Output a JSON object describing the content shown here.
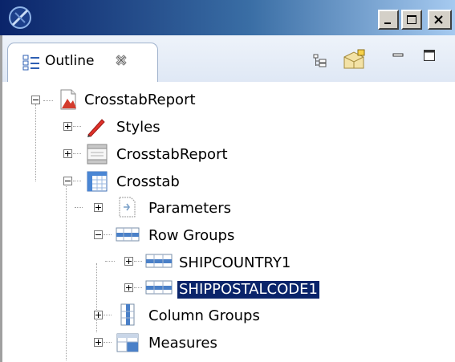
{
  "window": {
    "controls": {
      "minimize": "_",
      "maximize": "□",
      "close": "X"
    }
  },
  "outline_tab": {
    "label": "Outline",
    "icon": "outline-view-icon",
    "close_icon": "close-icon"
  },
  "toolbar": {
    "buttons": [
      "expand-all-icon",
      "filter-icon",
      "minimize-view-icon",
      "maximize-view-icon"
    ]
  },
  "tree": {
    "items": [
      {
        "label": "CrosstabReport",
        "icon": "report-icon",
        "expanded": true
      },
      {
        "label": "Styles",
        "icon": "pencil-icon",
        "expanded": false
      },
      {
        "label": "CrosstabReport",
        "icon": "master-page-icon",
        "expanded": false
      },
      {
        "label": "Crosstab",
        "icon": "crosstab-icon",
        "expanded": true
      },
      {
        "label": "Parameters",
        "icon": "parameters-icon",
        "expanded": false
      },
      {
        "label": "Row Groups",
        "icon": "row-group-icon",
        "expanded": true
      },
      {
        "label": "SHIPCOUNTRY1",
        "icon": "row-group-item-icon",
        "expanded": false
      },
      {
        "label": "SHIPPOSTALCODE1",
        "icon": "row-group-item-icon",
        "expanded": false,
        "selected": true
      },
      {
        "label": "Column Groups",
        "icon": "column-group-icon",
        "expanded": false
      },
      {
        "label": "Measures",
        "icon": "measures-icon",
        "expanded": false
      }
    ]
  },
  "colors": {
    "selection": "#0a246a",
    "title_bar": "#0a246a"
  }
}
